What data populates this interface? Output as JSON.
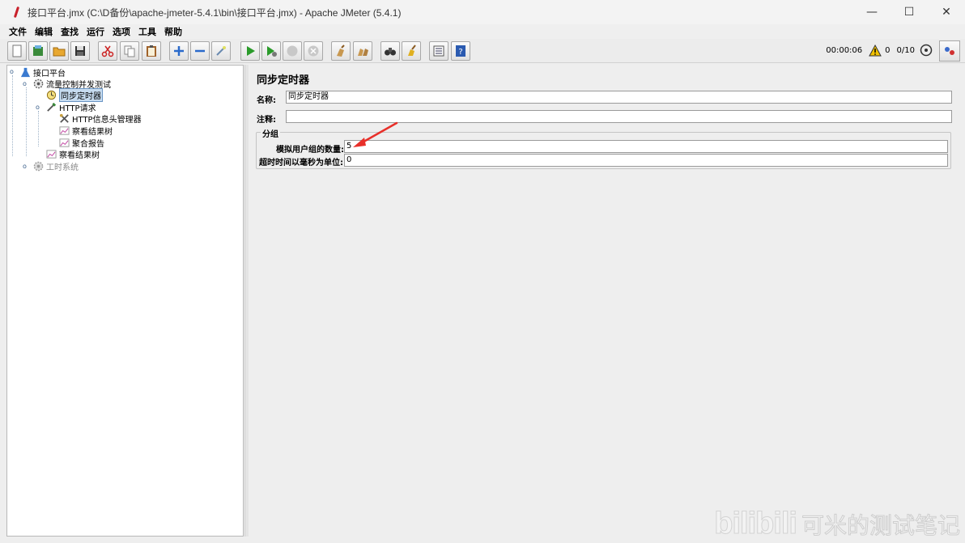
{
  "window": {
    "title": "接口平台.jmx (C:\\D备份\\apache-jmeter-5.4.1\\bin\\接口平台.jmx) - Apache JMeter (5.4.1)",
    "minimize": "—",
    "maximize": "☐",
    "close": "✕"
  },
  "menu": [
    "文件",
    "编辑",
    "查找",
    "运行",
    "选项",
    "工具",
    "帮助"
  ],
  "toolbar": {
    "buttons": [
      "new",
      "templates",
      "open",
      "save",
      "cut",
      "copy",
      "paste",
      "expand",
      "collapse",
      "toggle",
      "start",
      "start-no-pauses",
      "stop",
      "shutdown",
      "clear",
      "clear-all",
      "search",
      "reset-search",
      "function-helper",
      "help"
    ],
    "elapsed": "00:00:06",
    "warnings": "0",
    "threads": "0/10"
  },
  "tree": {
    "root": "接口平台",
    "thread_group": "流量控制并发测试",
    "sync_timer": "同步定时器",
    "http_request": "HTTP请求",
    "header_manager": "HTTP信息头管理器",
    "result_tree_1": "察看结果树",
    "aggregate_report": "聚合报告",
    "result_tree_2": "察看结果树",
    "disabled_group": "工时系统"
  },
  "form": {
    "title": "同步定时器",
    "name_label": "名称:",
    "name_value": "同步定时器",
    "comment_label": "注释:",
    "comment_value": "",
    "group_title": "分组",
    "users_label": "模拟用户组的数量:",
    "users_value": "5",
    "timeout_label": "超时时间以毫秒为单位:",
    "timeout_value": "0"
  },
  "watermark": {
    "logo": "bilibili",
    "text": "可米的测试笔记"
  },
  "colors": {
    "selection": "#c7dcf0",
    "arrow": "#e8302a",
    "start_green": "#2a9b2a"
  }
}
